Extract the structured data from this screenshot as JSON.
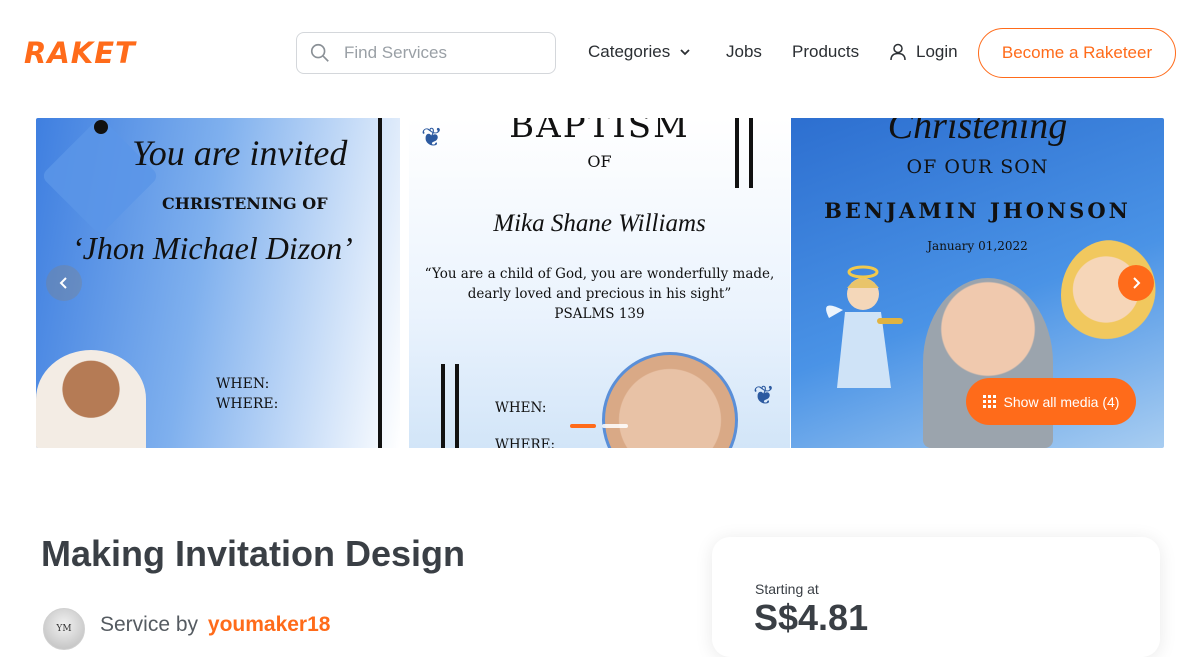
{
  "header": {
    "logo_text": "RAKET",
    "brand_color": "#ff6b1a",
    "search": {
      "placeholder": "Find Services",
      "value": "",
      "icon": "search-icon"
    },
    "nav": {
      "categories": "Categories",
      "jobs": "Jobs",
      "products": "Products",
      "login": "Login"
    },
    "cta": "Become a Raketeer"
  },
  "gallery": {
    "slides": [
      {
        "invited": "You are invited",
        "christening_of": "CHRISTENING OF",
        "name": "‘Jhon Michael Dizon’",
        "when": "WHEN:",
        "where": "WHERE:"
      },
      {
        "title": "BAPTISM",
        "of": "OF",
        "name": "Mika Shane Williams",
        "quote_line1": "“You are a child of God, you are wonderfully made,",
        "quote_line2": "dearly loved and precious in his sight”",
        "quote_line3": "PSALMS 139",
        "when": "WHEN:",
        "where": "WHERE:"
      },
      {
        "christening": "Christening",
        "of_our_son": "OF OUR SON",
        "name": "BENJAMIN JHONSON",
        "date": "January 01,2022"
      }
    ],
    "active_dot": 0,
    "dot_count": 2,
    "show_all_media": "Show all media (4)"
  },
  "service": {
    "title": "Making Invitation Design",
    "service_by_label": "Service by",
    "username": "youmaker18",
    "avatar_initials": "YM"
  },
  "pricing": {
    "starting_at_label": "Starting at",
    "price": "S$4.81"
  }
}
